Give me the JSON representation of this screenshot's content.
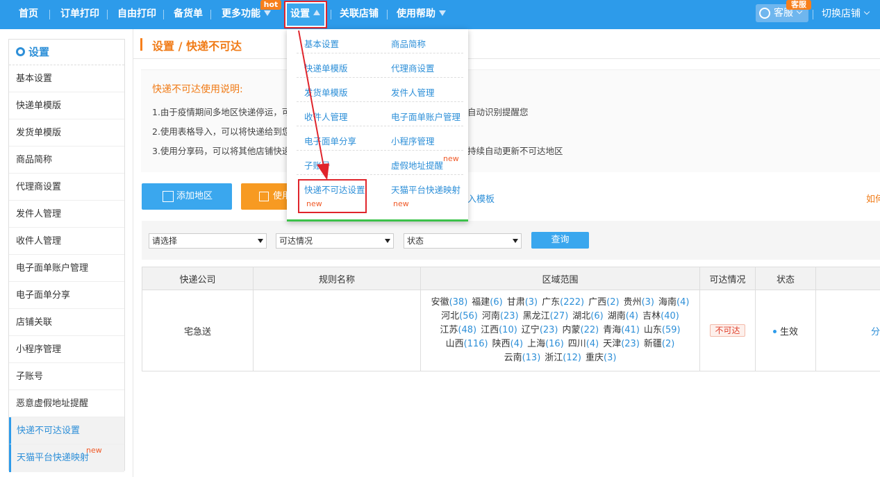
{
  "nav": {
    "items": [
      "首页",
      "订单打印",
      "自由打印",
      "备货单",
      "更多功能",
      "设置",
      "关联店铺",
      "使用帮助"
    ],
    "hot_badge": "hot",
    "kefu_label": "客服",
    "kefu_badge": "客服",
    "switch_shop": "切换店铺"
  },
  "sidebar": {
    "title": "设置",
    "items": [
      "基本设置",
      "快递单模版",
      "发货单模版",
      "商品简称",
      "代理商设置",
      "发件人管理",
      "收件人管理",
      "电子面单账户管理",
      "电子面单分享",
      "店铺关联",
      "小程序管理",
      "子账号",
      "恶意虚假地址提醒",
      "快递不可达设置",
      "天猫平台快递映射"
    ],
    "active_index": 13,
    "new_label": "new"
  },
  "breadcrumb": {
    "part1": "设置",
    "sep": " / ",
    "part2": "快递不可达"
  },
  "info": {
    "title": "快递不可达使用说明:",
    "line1": "1.由于疫情期间多地区快递停运，可以",
    "line1_tail": "自动识别提醒您",
    "line2": "2.使用表格导入，可以将快递给到您的",
    "line3": "3.使用分享码，可以将其他店铺快递网",
    "line3_tail": "持续自动更新不可达地区"
  },
  "toolbar": {
    "add_region": "添加地区",
    "use_share": "使用",
    "import_template": "入模板",
    "how_to": "如何"
  },
  "filters": {
    "select1": "请选择",
    "select2": "可达情况",
    "select3": "状态",
    "query": "查询"
  },
  "table": {
    "headers": [
      "快递公司",
      "规则名称",
      "区域范围",
      "可达情况",
      "状态",
      ""
    ],
    "row": {
      "company": "宅急送",
      "rule_name": "",
      "regions": [
        {
          "name": "安徽",
          "count": "(38)"
        },
        {
          "name": "福建",
          "count": "(6)"
        },
        {
          "name": "甘肃",
          "count": "(3)"
        },
        {
          "name": "广东",
          "count": "(222)"
        },
        {
          "name": "广西",
          "count": "(2)"
        },
        {
          "name": "贵州",
          "count": "(3)"
        },
        {
          "name": "海南",
          "count": "(4)"
        },
        {
          "name": "河北",
          "count": "(56)"
        },
        {
          "name": "河南",
          "count": "(23)"
        },
        {
          "name": "黑龙江",
          "count": "(27)"
        },
        {
          "name": "湖北",
          "count": "(6)"
        },
        {
          "name": "湖南",
          "count": "(4)"
        },
        {
          "name": "吉林",
          "count": "(40)"
        },
        {
          "name": "江苏",
          "count": "(48)"
        },
        {
          "name": "江西",
          "count": "(10)"
        },
        {
          "name": "辽宁",
          "count": "(23)"
        },
        {
          "name": "内蒙",
          "count": "(22)"
        },
        {
          "name": "青海",
          "count": "(41)"
        },
        {
          "name": "山东",
          "count": "(59)"
        },
        {
          "name": "山西",
          "count": "(116)"
        },
        {
          "name": "陕西",
          "count": "(4)"
        },
        {
          "name": "上海",
          "count": "(16)"
        },
        {
          "name": "四川",
          "count": "(4)"
        },
        {
          "name": "天津",
          "count": "(23)"
        },
        {
          "name": "新疆",
          "count": "(2)"
        },
        {
          "name": "云南",
          "count": "(13)"
        },
        {
          "name": "浙江",
          "count": "(12)"
        },
        {
          "name": "重庆",
          "count": "(3)"
        }
      ],
      "reach": "不可达",
      "status": "生效",
      "op": "分"
    }
  },
  "dropdown": {
    "rows": [
      [
        "基本设置",
        "商品简称"
      ],
      [
        "快递单模版",
        "代理商设置"
      ],
      [
        "发货单模版",
        "发件人管理"
      ],
      [
        "收件人管理",
        "电子面单账户管理"
      ],
      [
        "电子面单分享",
        "小程序管理"
      ],
      [
        "子账号",
        "虚假地址提醒"
      ],
      [
        "快递不可达设置",
        "天猫平台快递映射"
      ]
    ],
    "new_label": "new"
  },
  "colors": {
    "nav_bg": "#2d9bea",
    "accent_orange": "#f07b17",
    "highlight_red": "#e0242b",
    "link_blue": "#2d8fd8"
  }
}
